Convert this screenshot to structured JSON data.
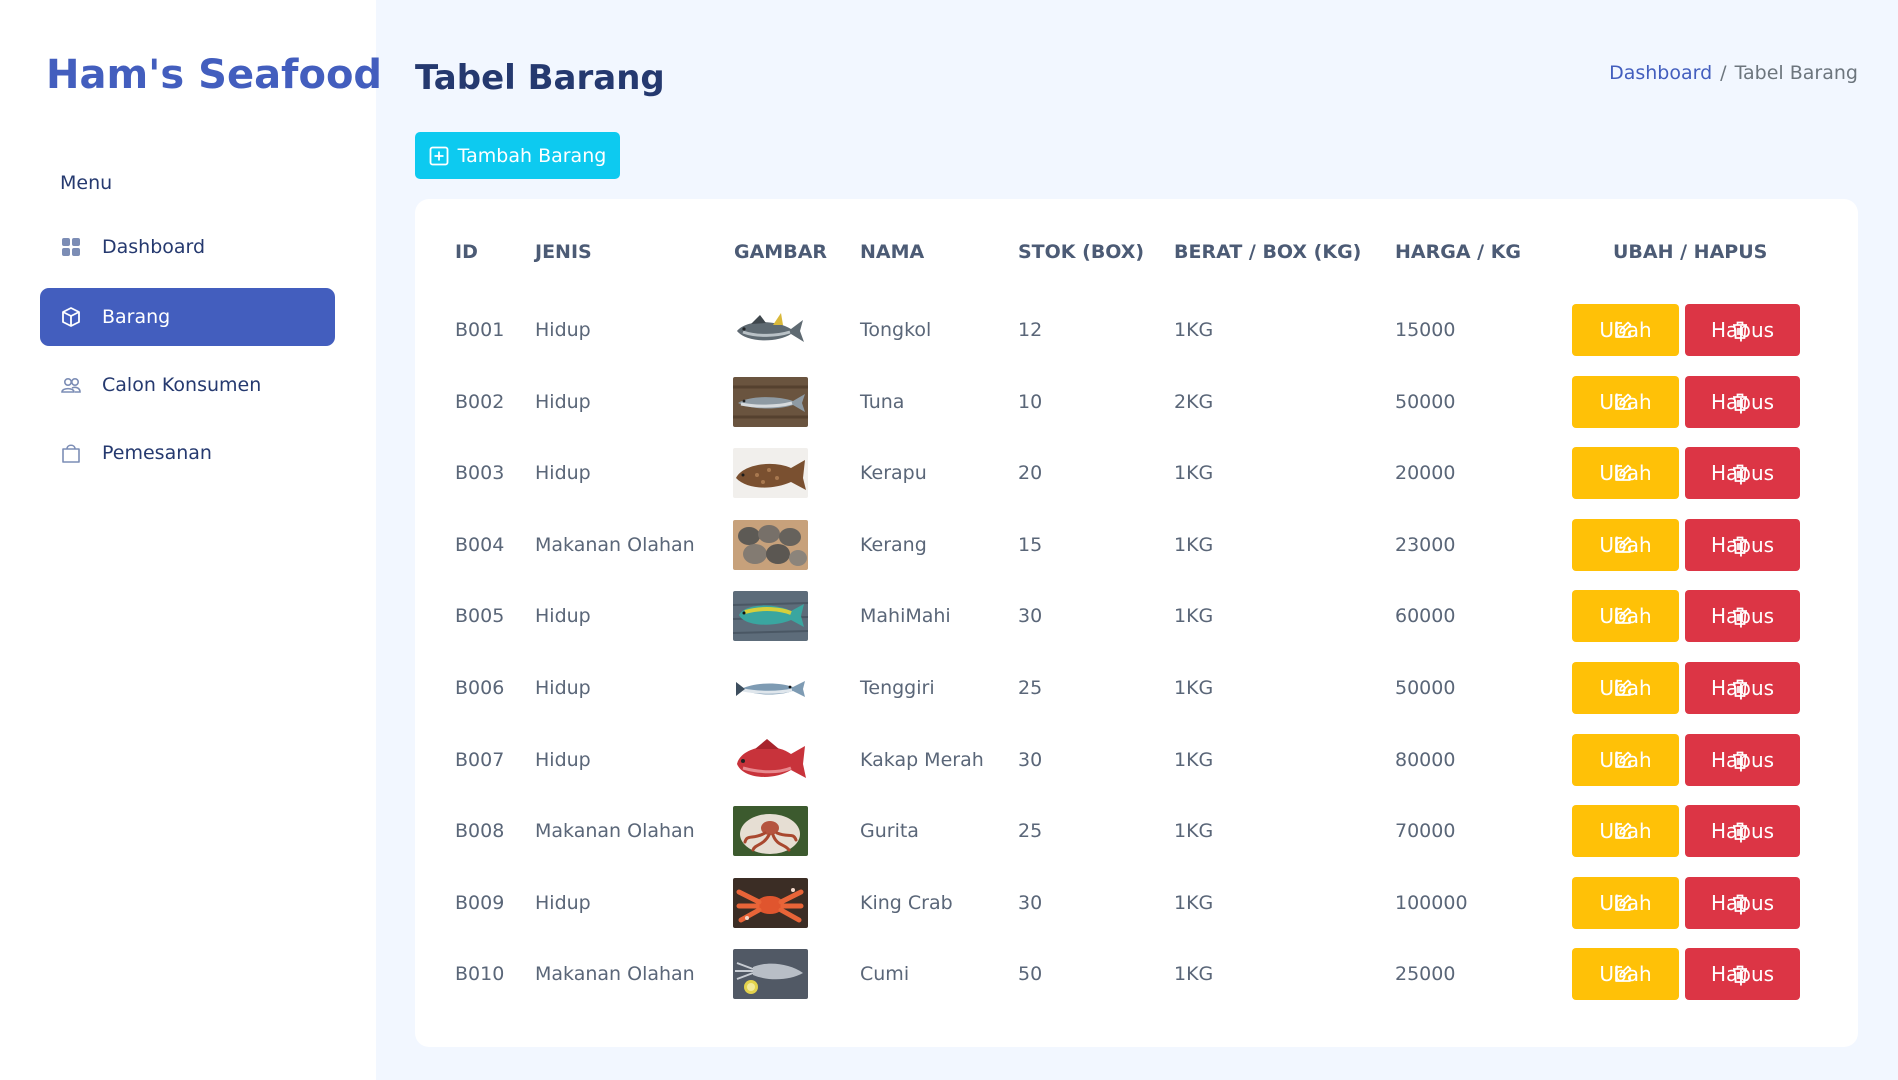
{
  "sidebar": {
    "brand": "Ham's Seafood",
    "menu_title": "Menu",
    "items": [
      {
        "label": "Dashboard",
        "icon": "grid-icon",
        "active": false
      },
      {
        "label": "Barang",
        "icon": "box-icon",
        "active": true
      },
      {
        "label": "Calon Konsumen",
        "icon": "people-icon",
        "active": false
      },
      {
        "label": "Pemesanan",
        "icon": "bag-icon",
        "active": false
      }
    ]
  },
  "header": {
    "title": "Tabel Barang",
    "breadcrumb": [
      "Dashboard",
      "Tabel Barang"
    ],
    "breadcrumb_separator": "/"
  },
  "add_button_label": "Tambah Barang",
  "table": {
    "headers": [
      "ID",
      "JENIS",
      "GAMBAR",
      "NAMA",
      "STOK (BOX)",
      "BERAT / BOX (KG)",
      "HARGA / KG",
      "UBAH / HAPUS"
    ],
    "rows": [
      {
        "id": "B001",
        "jenis": "Hidup",
        "nama": "Tongkol",
        "stok": "12",
        "berat": "1KG",
        "harga": "15000",
        "image": "tongkol-fish-image"
      },
      {
        "id": "B002",
        "jenis": "Hidup",
        "nama": "Tuna",
        "stok": "10",
        "berat": "2KG",
        "harga": "50000",
        "image": "tuna-fish-image"
      },
      {
        "id": "B003",
        "jenis": "Hidup",
        "nama": "Kerapu",
        "stok": "20",
        "berat": "1KG",
        "harga": "20000",
        "image": "kerapu-fish-image"
      },
      {
        "id": "B004",
        "jenis": "Makanan Olahan",
        "nama": "Kerang",
        "stok": "15",
        "berat": "1KG",
        "harga": "23000",
        "image": "kerang-shells-image"
      },
      {
        "id": "B005",
        "jenis": "Hidup",
        "nama": "MahiMahi",
        "stok": "30",
        "berat": "1KG",
        "harga": "60000",
        "image": "mahimahi-fish-image"
      },
      {
        "id": "B006",
        "jenis": "Hidup",
        "nama": "Tenggiri",
        "stok": "25",
        "berat": "1KG",
        "harga": "50000",
        "image": "tenggiri-fish-image"
      },
      {
        "id": "B007",
        "jenis": "Hidup",
        "nama": "Kakap Merah",
        "stok": "30",
        "berat": "1KG",
        "harga": "80000",
        "image": "kakap-merah-fish-image"
      },
      {
        "id": "B008",
        "jenis": "Makanan Olahan",
        "nama": "Gurita",
        "stok": "25",
        "berat": "1KG",
        "harga": "70000",
        "image": "gurita-octopus-image"
      },
      {
        "id": "B009",
        "jenis": "Hidup",
        "nama": "King Crab",
        "stok": "30",
        "berat": "1KG",
        "harga": "100000",
        "image": "king-crab-image"
      },
      {
        "id": "B010",
        "jenis": "Makanan Olahan",
        "nama": "Cumi",
        "stok": "50",
        "berat": "1KG",
        "harga": "25000",
        "image": "cumi-squid-image"
      }
    ],
    "edit_label": "Ubah",
    "delete_label": "Hapus"
  },
  "colors": {
    "primary": "#435ebe",
    "background": "#f2f7ff",
    "info": "#0dcaf0",
    "warning": "#ffc107",
    "danger": "#dc3545",
    "heading": "#25396f"
  }
}
